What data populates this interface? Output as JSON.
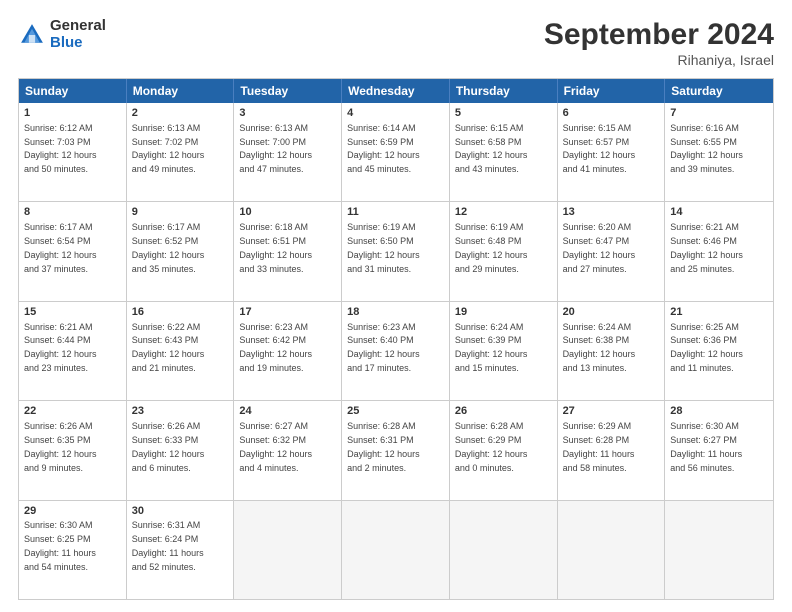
{
  "header": {
    "logo_general": "General",
    "logo_blue": "Blue",
    "month_title": "September 2024",
    "location": "Rihaniya, Israel"
  },
  "weekdays": [
    "Sunday",
    "Monday",
    "Tuesday",
    "Wednesday",
    "Thursday",
    "Friday",
    "Saturday"
  ],
  "rows": [
    [
      {
        "day": "1",
        "info": "Sunrise: 6:12 AM\nSunset: 7:03 PM\nDaylight: 12 hours\nand 50 minutes."
      },
      {
        "day": "2",
        "info": "Sunrise: 6:13 AM\nSunset: 7:02 PM\nDaylight: 12 hours\nand 49 minutes."
      },
      {
        "day": "3",
        "info": "Sunrise: 6:13 AM\nSunset: 7:00 PM\nDaylight: 12 hours\nand 47 minutes."
      },
      {
        "day": "4",
        "info": "Sunrise: 6:14 AM\nSunset: 6:59 PM\nDaylight: 12 hours\nand 45 minutes."
      },
      {
        "day": "5",
        "info": "Sunrise: 6:15 AM\nSunset: 6:58 PM\nDaylight: 12 hours\nand 43 minutes."
      },
      {
        "day": "6",
        "info": "Sunrise: 6:15 AM\nSunset: 6:57 PM\nDaylight: 12 hours\nand 41 minutes."
      },
      {
        "day": "7",
        "info": "Sunrise: 6:16 AM\nSunset: 6:55 PM\nDaylight: 12 hours\nand 39 minutes."
      }
    ],
    [
      {
        "day": "8",
        "info": "Sunrise: 6:17 AM\nSunset: 6:54 PM\nDaylight: 12 hours\nand 37 minutes."
      },
      {
        "day": "9",
        "info": "Sunrise: 6:17 AM\nSunset: 6:52 PM\nDaylight: 12 hours\nand 35 minutes."
      },
      {
        "day": "10",
        "info": "Sunrise: 6:18 AM\nSunset: 6:51 PM\nDaylight: 12 hours\nand 33 minutes."
      },
      {
        "day": "11",
        "info": "Sunrise: 6:19 AM\nSunset: 6:50 PM\nDaylight: 12 hours\nand 31 minutes."
      },
      {
        "day": "12",
        "info": "Sunrise: 6:19 AM\nSunset: 6:48 PM\nDaylight: 12 hours\nand 29 minutes."
      },
      {
        "day": "13",
        "info": "Sunrise: 6:20 AM\nSunset: 6:47 PM\nDaylight: 12 hours\nand 27 minutes."
      },
      {
        "day": "14",
        "info": "Sunrise: 6:21 AM\nSunset: 6:46 PM\nDaylight: 12 hours\nand 25 minutes."
      }
    ],
    [
      {
        "day": "15",
        "info": "Sunrise: 6:21 AM\nSunset: 6:44 PM\nDaylight: 12 hours\nand 23 minutes."
      },
      {
        "day": "16",
        "info": "Sunrise: 6:22 AM\nSunset: 6:43 PM\nDaylight: 12 hours\nand 21 minutes."
      },
      {
        "day": "17",
        "info": "Sunrise: 6:23 AM\nSunset: 6:42 PM\nDaylight: 12 hours\nand 19 minutes."
      },
      {
        "day": "18",
        "info": "Sunrise: 6:23 AM\nSunset: 6:40 PM\nDaylight: 12 hours\nand 17 minutes."
      },
      {
        "day": "19",
        "info": "Sunrise: 6:24 AM\nSunset: 6:39 PM\nDaylight: 12 hours\nand 15 minutes."
      },
      {
        "day": "20",
        "info": "Sunrise: 6:24 AM\nSunset: 6:38 PM\nDaylight: 12 hours\nand 13 minutes."
      },
      {
        "day": "21",
        "info": "Sunrise: 6:25 AM\nSunset: 6:36 PM\nDaylight: 12 hours\nand 11 minutes."
      }
    ],
    [
      {
        "day": "22",
        "info": "Sunrise: 6:26 AM\nSunset: 6:35 PM\nDaylight: 12 hours\nand 9 minutes."
      },
      {
        "day": "23",
        "info": "Sunrise: 6:26 AM\nSunset: 6:33 PM\nDaylight: 12 hours\nand 6 minutes."
      },
      {
        "day": "24",
        "info": "Sunrise: 6:27 AM\nSunset: 6:32 PM\nDaylight: 12 hours\nand 4 minutes."
      },
      {
        "day": "25",
        "info": "Sunrise: 6:28 AM\nSunset: 6:31 PM\nDaylight: 12 hours\nand 2 minutes."
      },
      {
        "day": "26",
        "info": "Sunrise: 6:28 AM\nSunset: 6:29 PM\nDaylight: 12 hours\nand 0 minutes."
      },
      {
        "day": "27",
        "info": "Sunrise: 6:29 AM\nSunset: 6:28 PM\nDaylight: 11 hours\nand 58 minutes."
      },
      {
        "day": "28",
        "info": "Sunrise: 6:30 AM\nSunset: 6:27 PM\nDaylight: 11 hours\nand 56 minutes."
      }
    ],
    [
      {
        "day": "29",
        "info": "Sunrise: 6:30 AM\nSunset: 6:25 PM\nDaylight: 11 hours\nand 54 minutes."
      },
      {
        "day": "30",
        "info": "Sunrise: 6:31 AM\nSunset: 6:24 PM\nDaylight: 11 hours\nand 52 minutes."
      },
      {
        "day": "",
        "info": ""
      },
      {
        "day": "",
        "info": ""
      },
      {
        "day": "",
        "info": ""
      },
      {
        "day": "",
        "info": ""
      },
      {
        "day": "",
        "info": ""
      }
    ]
  ]
}
